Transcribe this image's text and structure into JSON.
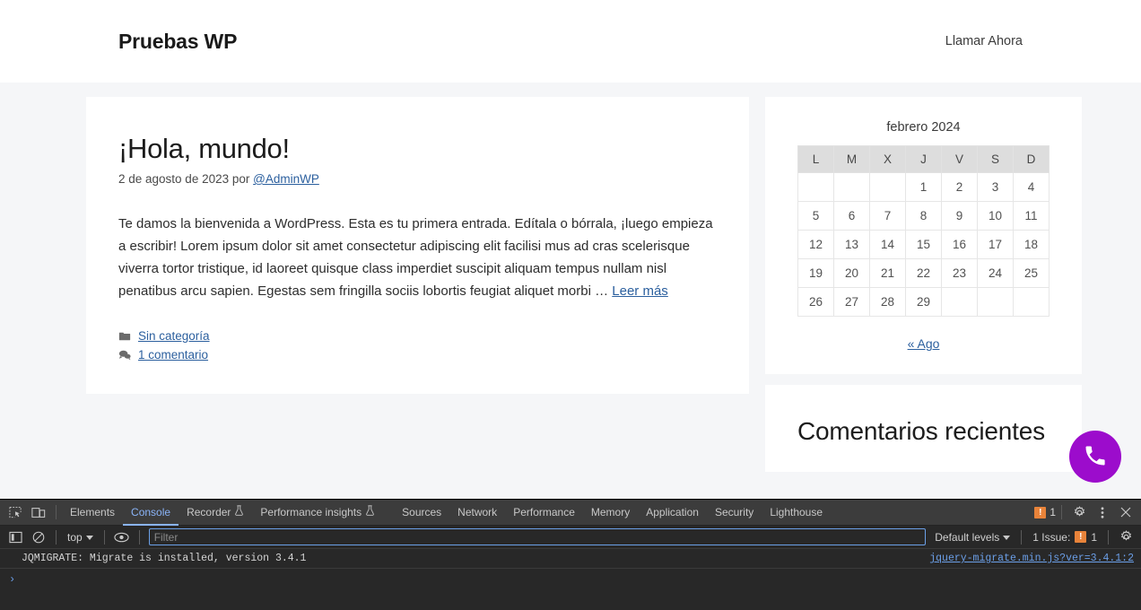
{
  "site": {
    "title": "Pruebas WP",
    "nav": [
      {
        "label": "Llamar Ahora"
      }
    ],
    "fab": {
      "icon": "phone-icon",
      "color": "#9c0ccc"
    }
  },
  "post": {
    "title": "¡Hola, mundo!",
    "meta_date": "2 de agosto de 2023 por ",
    "meta_author": "@AdminWP",
    "body": "Te damos la bienvenida a WordPress. Esta es tu primera entrada. Edítala o bórrala, ¡luego empieza a escribir! Lorem ipsum dolor sit amet consectetur adipiscing elit facilisi mus ad cras scelerisque viverra tortor tristique, id laoreet quisque class imperdiet suscipit aliquam tempus nullam nisl penatibus arcu sapien. Egestas sem fringilla sociis lobortis feugiat aliquet morbi … ",
    "read_more": "Leer más",
    "category_icon": "folder-icon",
    "category": "Sin categoría",
    "comments_icon": "comment-icon",
    "comments": "1 comentario"
  },
  "calendar": {
    "caption": "febrero 2024",
    "day_headers": [
      "L",
      "M",
      "X",
      "J",
      "V",
      "S",
      "D"
    ],
    "weeks": [
      [
        "",
        "",
        "",
        "1",
        "2",
        "3",
        "4"
      ],
      [
        "5",
        "6",
        "7",
        "8",
        "9",
        "10",
        "11"
      ],
      [
        "12",
        "13",
        "14",
        "15",
        "16",
        "17",
        "18"
      ],
      [
        "19",
        "20",
        "21",
        "22",
        "23",
        "24",
        "25"
      ],
      [
        "26",
        "27",
        "28",
        "29",
        "",
        "",
        ""
      ]
    ],
    "prev_link": "« Ago"
  },
  "recent_comments": {
    "title": "Comentarios recientes"
  },
  "devtools": {
    "toolbar_icons": [
      "inspect-element-icon",
      "device-toolbar-icon"
    ],
    "tabs": [
      {
        "label": "Elements",
        "active": false,
        "icon": null
      },
      {
        "label": "Console",
        "active": true,
        "icon": null
      },
      {
        "label": "Recorder",
        "active": false,
        "icon": "flask-icon"
      },
      {
        "label": "Performance insights",
        "active": false,
        "icon": "flask-icon"
      },
      {
        "label": "Sources",
        "active": false,
        "icon": null
      },
      {
        "label": "Network",
        "active": false,
        "icon": null
      },
      {
        "label": "Performance",
        "active": false,
        "icon": null
      },
      {
        "label": "Memory",
        "active": false,
        "icon": null
      },
      {
        "label": "Application",
        "active": false,
        "icon": null
      },
      {
        "label": "Security",
        "active": false,
        "icon": null
      },
      {
        "label": "Lighthouse",
        "active": false,
        "icon": null
      }
    ],
    "warning_count": "1",
    "warning_badge_char": "!",
    "settings_icon": "gear-icon",
    "more_icon": "kebab-menu-icon",
    "close_icon": "close-icon",
    "filterbar": {
      "sidebar_icon": "console-sidebar-icon",
      "clear_icon": "clear-console-icon",
      "context": "top",
      "eye_icon": "live-expression-icon",
      "filter_placeholder": "Filter",
      "filter_value": "",
      "levels": "Default levels",
      "issues_label": "1 Issue:",
      "issues_count": "1"
    },
    "console": {
      "message": "JQMIGRATE: Migrate is installed, version 3.4.1",
      "source": "jquery-migrate.min.js?ver=3.4.1:2",
      "prompt": "›"
    }
  }
}
